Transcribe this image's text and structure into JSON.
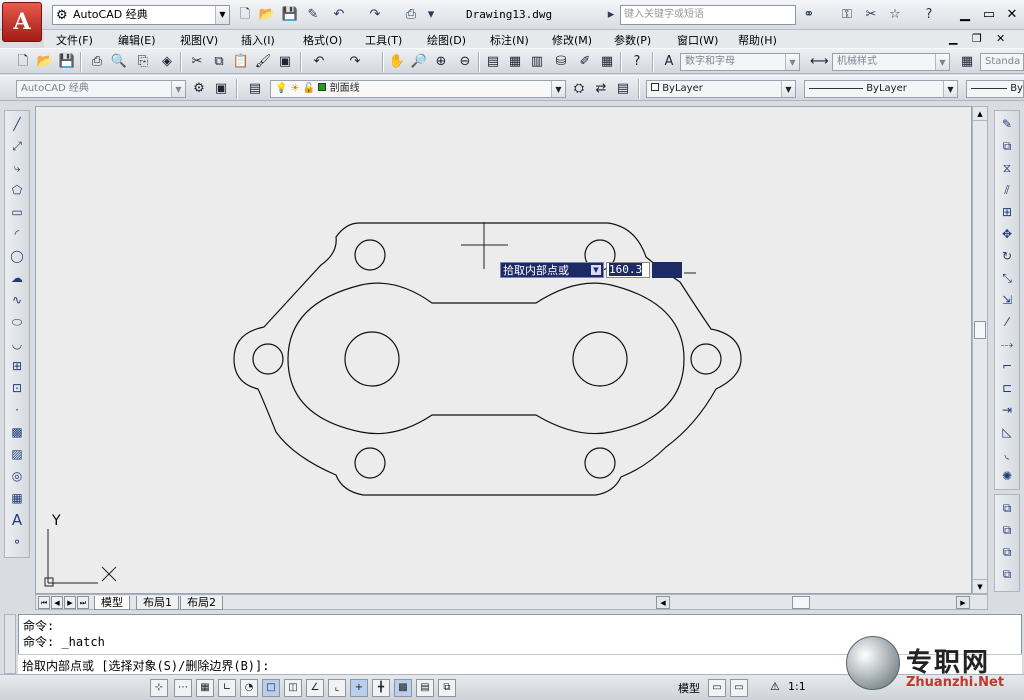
{
  "app": {
    "logo_letter": "A",
    "workspace": "AutoCAD 经典",
    "document_title": "Drawing13.dwg",
    "search_placeholder": "键入关键字或短语"
  },
  "menu": [
    "文件(F)",
    "编辑(E)",
    "视图(V)",
    "插入(I)",
    "格式(O)",
    "工具(T)",
    "绘图(D)",
    "标注(N)",
    "修改(M)",
    "参数(P)",
    "窗口(W)",
    "帮助(H)"
  ],
  "toolbar1": {
    "text_style": "数字和字母",
    "dim_style": "机械样式",
    "table_style": "Standa"
  },
  "toolbar2": {
    "workspace": "AutoCAD 经典",
    "layer": "剖面线",
    "color": "ByLayer",
    "linetype": "ByLayer",
    "lineweight": "By"
  },
  "drawing": {
    "axis_y": "Y",
    "axis_x": "X",
    "tooltip_label": "拾取内部点或",
    "dynamic_value": "160.3"
  },
  "tabs": [
    "模型",
    "布局1",
    "布局2"
  ],
  "command": {
    "line1": "命令:",
    "line2": "命令: _hatch",
    "prompt": "拾取内部点或 [选择对象(S)/删除边界(B)]:"
  },
  "status": {
    "space": "模型",
    "scale": "1:1"
  },
  "watermark": {
    "text": "专职网",
    "url": "Zhuanzhi.Net"
  },
  "colors": {
    "title_bar": "#e3e6ea",
    "canvas": "#ececec",
    "tooltip": "#1e2a66",
    "logo": "#c0281d"
  }
}
